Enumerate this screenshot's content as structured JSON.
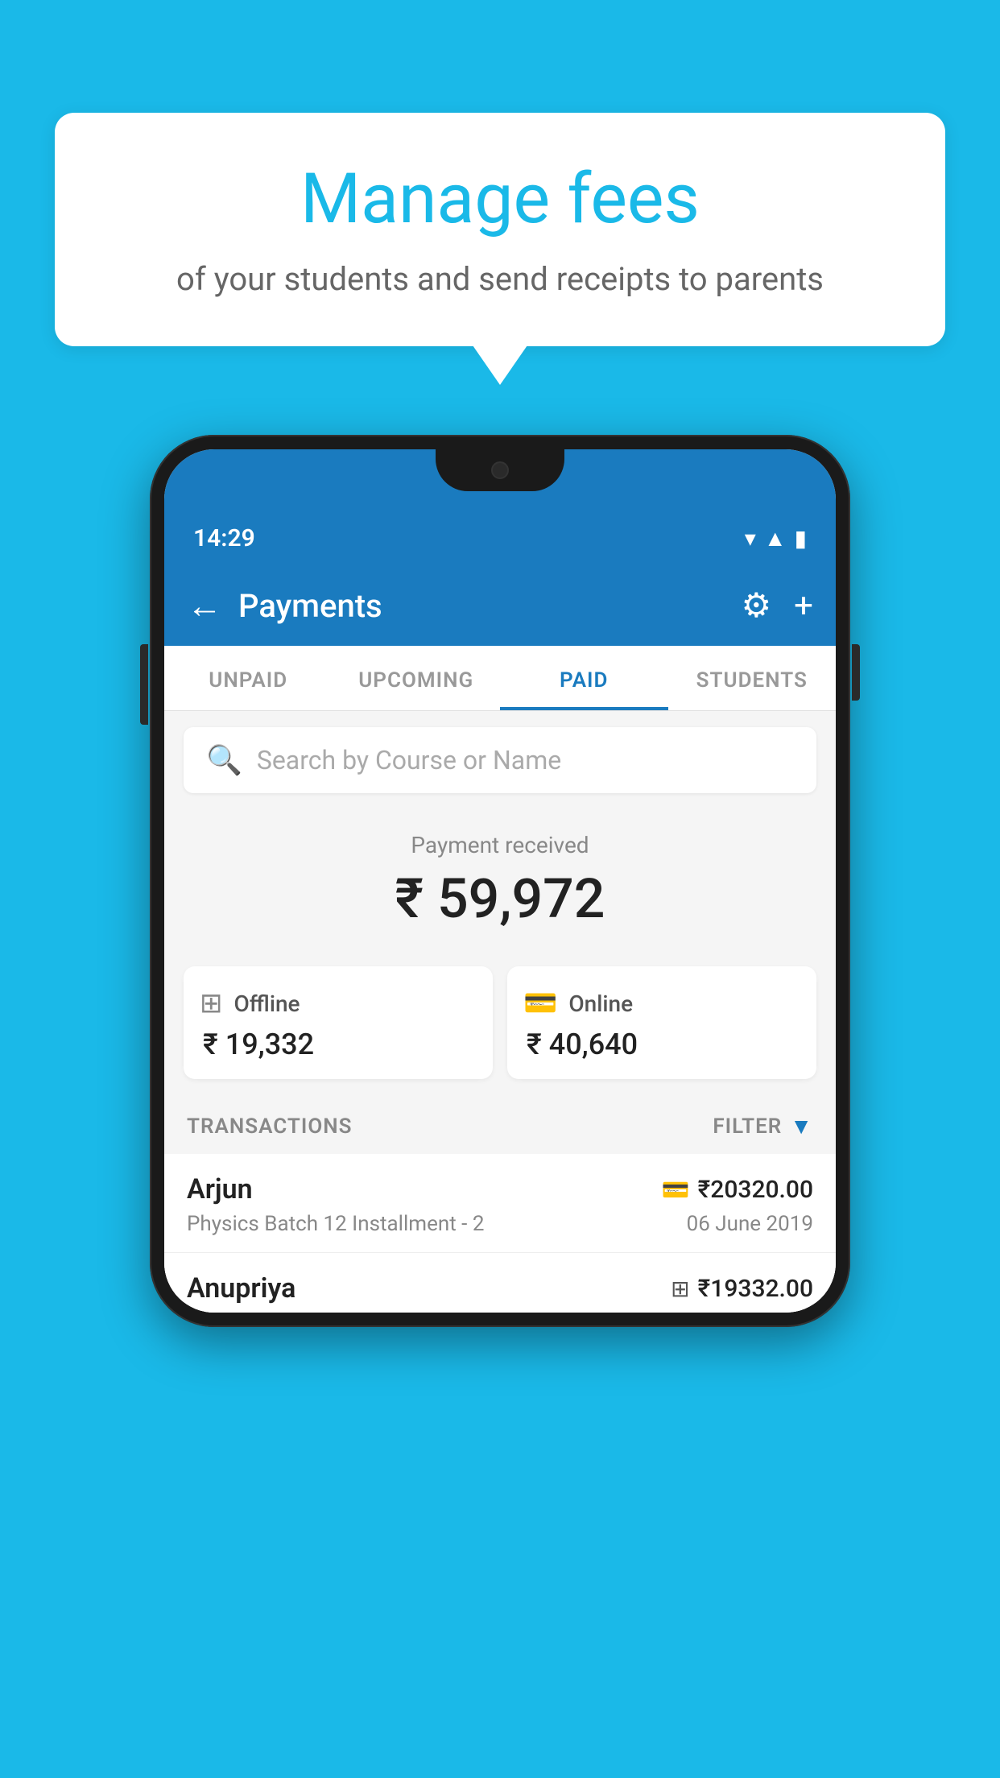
{
  "bubble": {
    "title": "Manage fees",
    "subtitle": "of your students and send receipts to parents"
  },
  "phone": {
    "status": {
      "time": "14:29"
    },
    "header": {
      "title": "Payments",
      "back_label": "←",
      "settings_label": "⚙",
      "add_label": "+"
    },
    "tabs": [
      {
        "label": "UNPAID",
        "active": false
      },
      {
        "label": "UPCOMING",
        "active": false
      },
      {
        "label": "PAID",
        "active": true
      },
      {
        "label": "STUDENTS",
        "active": false
      }
    ],
    "search": {
      "placeholder": "Search by Course or Name"
    },
    "payment_summary": {
      "label": "Payment received",
      "total": "₹ 59,972",
      "offline": {
        "type": "Offline",
        "amount": "₹ 19,332"
      },
      "online": {
        "type": "Online",
        "amount": "₹ 40,640"
      }
    },
    "transactions_label": "TRANSACTIONS",
    "filter_label": "FILTER",
    "transactions": [
      {
        "name": "Arjun",
        "course": "Physics Batch 12 Installment - 2",
        "date": "06 June 2019",
        "amount": "₹20320.00",
        "mode": "online"
      },
      {
        "name": "Anupriya",
        "course": "",
        "date": "",
        "amount": "₹19332.00",
        "mode": "offline"
      }
    ]
  },
  "colors": {
    "brand_blue": "#1a7bbf",
    "sky_blue": "#1ab9e8",
    "white": "#ffffff"
  }
}
